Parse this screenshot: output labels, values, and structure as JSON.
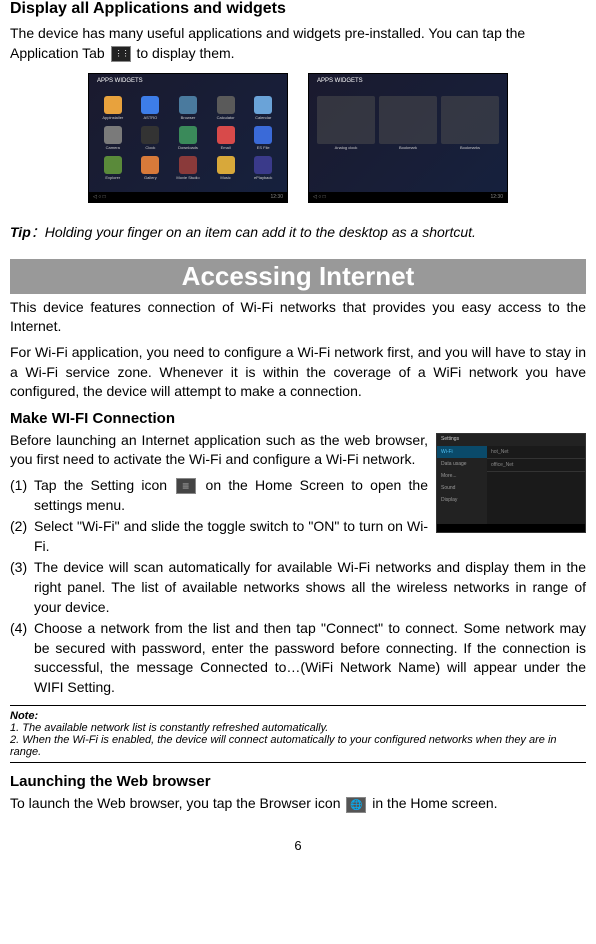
{
  "section1": {
    "heading": "Display all Applications and widgets",
    "para_pre": "The device has many useful applications and widgets pre-installed. You can tap the Application Tab ",
    "para_post": " to display them."
  },
  "screenshots": {
    "tabs1": "APPS    WIDGETS",
    "tabs2": "APPS    WIDGETS",
    "nav_time": "12:30",
    "apps": [
      {
        "label": "Appinstaller",
        "color": "#e8a23d"
      },
      {
        "label": "ASTRO",
        "color": "#3d7de8"
      },
      {
        "label": "Browser",
        "color": "#4a7a9e"
      },
      {
        "label": "Calculator",
        "color": "#5a5a5a"
      },
      {
        "label": "Calendar",
        "color": "#6aa3d8"
      },
      {
        "label": "Camera",
        "color": "#7a7a7a"
      },
      {
        "label": "Clock",
        "color": "#333"
      },
      {
        "label": "Downloads",
        "color": "#3a8a5a"
      },
      {
        "label": "Email",
        "color": "#d84a4a"
      },
      {
        "label": "ES File",
        "color": "#3a6ad8"
      },
      {
        "label": "Explorer",
        "color": "#5a8a3a"
      },
      {
        "label": "Gallery",
        "color": "#d87a3a"
      },
      {
        "label": "Movie Studio",
        "color": "#8a3a3a"
      },
      {
        "label": "Music",
        "color": "#d8a83a"
      },
      {
        "label": "ePlayback",
        "color": "#3a3a8a"
      }
    ],
    "widgets": [
      {
        "label": "Analog clock"
      },
      {
        "label": "Bookmark"
      },
      {
        "label": "Bookmarks"
      }
    ]
  },
  "tip": {
    "label": "Tip",
    "colon": "：",
    "text": "Holding your finger on an item can add it to the desktop as a shortcut."
  },
  "banner": "Accessing Internet",
  "intro": {
    "p1": "This device features connection of Wi-Fi networks that provides you easy access to the Internet.",
    "p2": "For Wi-Fi application, you need to configure a Wi-Fi network first, and you will have to stay in a Wi-Fi service zone. Whenever it is within the coverage of a WiFi network you have configured, the device will attempt to make a connection."
  },
  "wifi": {
    "heading": "Make WI-FI Connection",
    "intro": "Before launching an Internet application such as the web browser, you first need to activate the Wi-Fi and configure a Wi-Fi network.",
    "steps": [
      {
        "num": "(1)",
        "pre": "Tap the Setting icon ",
        "post": " on the Home Screen to open the settings menu."
      },
      {
        "num": "(2)",
        "text": "Select \"Wi-Fi\" and slide the toggle switch to \"ON\" to turn on Wi-Fi."
      },
      {
        "num": "(3)",
        "text": "The device will scan automatically for available Wi-Fi networks and display them in the right panel. The list of available networks shows all the wireless networks in range of your device."
      },
      {
        "num": "(4)",
        "text": "Choose a network from the list and then tap \"Connect\" to connect. Some network may be secured with password, enter the password before connecting. If the connection is successful, the message Connected to…(WiFi Network Name) will appear under the WIFI Setting."
      }
    ],
    "settings_screenshot": {
      "header": "Settings",
      "sidebar": [
        "Wi-Fi",
        "Data usage",
        "More...",
        "Sound",
        "Display"
      ],
      "networks": [
        "hot_Net",
        "office_Net"
      ]
    }
  },
  "note": {
    "label": "Note:",
    "n1": "1. The available network list is constantly refreshed automatically.",
    "n2": "2. When the Wi-Fi is enabled, the device will connect automatically to your configured networks when they are in range."
  },
  "browser": {
    "heading": "Launching the Web browser",
    "pre": "To launch the Web browser, you tap the Browser icon ",
    "post": " in the Home screen."
  },
  "page_number": "6"
}
